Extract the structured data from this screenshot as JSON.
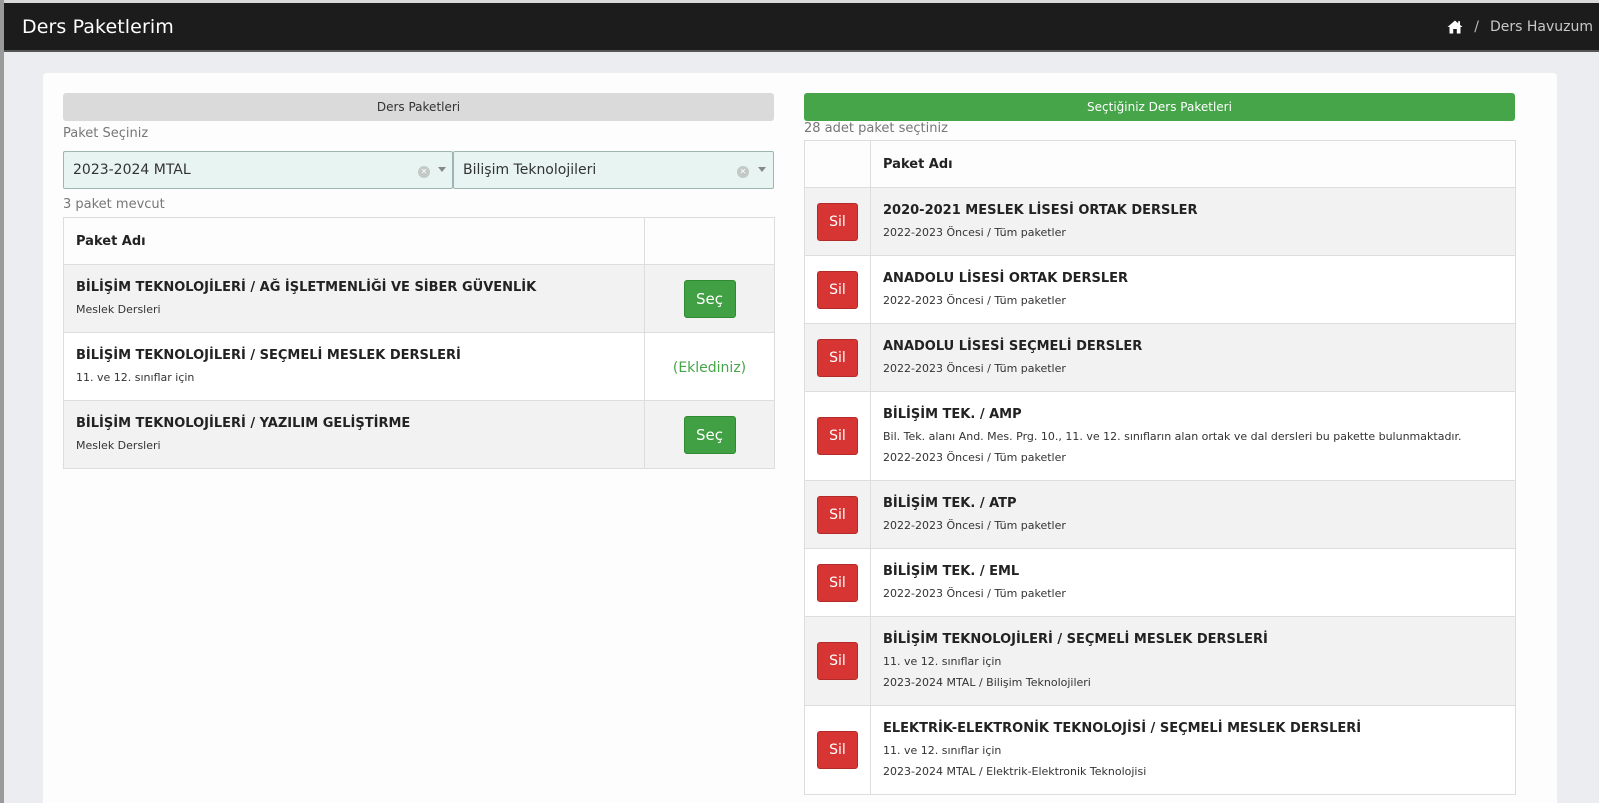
{
  "header": {
    "title": "Ders Paketlerim",
    "home_icon": "home-icon",
    "breadcrumb_sep": "/",
    "breadcrumb_link": "Ders Havuzum"
  },
  "left": {
    "header": "Ders Paketleri",
    "select_label": "Paket Seçiniz",
    "year_select": {
      "value": "2023-2024 MTAL"
    },
    "area_select": {
      "value": "Bilişim Teknolojileri"
    },
    "count_text": "3 paket mevcut",
    "table": {
      "col_name": "Paket Adı",
      "rows": [
        {
          "name": "BİLİŞİM TEKNOLOJİLERİ / AĞ İŞLETMENLİĞİ VE SİBER GÜVENLİK",
          "sub": "Meslek Dersleri",
          "action": "Seç"
        },
        {
          "name": "BİLİŞİM TEKNOLOJİLERİ / SEÇMELİ MESLEK DERSLERİ",
          "sub": "11. ve 12. sınıflar için",
          "action": "(Eklediniz)"
        },
        {
          "name": "BİLİŞİM TEKNOLOJİLERİ / YAZILIM GELİŞTİRME",
          "sub": "Meslek Dersleri",
          "action": "Seç"
        }
      ]
    }
  },
  "right": {
    "header": "Seçtiğiniz Ders Paketleri",
    "count_text": "28 adet paket seçtiniz",
    "table": {
      "col_name": "Paket Adı",
      "action_label": "Sil",
      "rows": [
        {
          "name": "2020-2021 MESLEK LİSESİ ORTAK DERSLER",
          "desc": "",
          "sub": "2022-2023 Öncesi / Tüm paketler"
        },
        {
          "name": "ANADOLU LİSESİ ORTAK DERSLER",
          "desc": "",
          "sub": "2022-2023 Öncesi / Tüm paketler"
        },
        {
          "name": "ANADOLU LİSESİ SEÇMELİ DERSLER",
          "desc": "",
          "sub": "2022-2023 Öncesi / Tüm paketler"
        },
        {
          "name": "BİLİŞİM TEK. / AMP",
          "desc": "Bil. Tek. alanı And. Mes. Prg. 10., 11. ve 12. sınıfların alan ortak ve dal dersleri bu pakette bulunmaktadır.",
          "sub": "2022-2023 Öncesi / Tüm paketler"
        },
        {
          "name": "BİLİŞİM TEK. / ATP",
          "desc": "",
          "sub": "2022-2023 Öncesi / Tüm paketler"
        },
        {
          "name": "BİLİŞİM TEK. / EML",
          "desc": "",
          "sub": "2022-2023 Öncesi / Tüm paketler"
        },
        {
          "name": "BİLİŞİM TEKNOLOJİLERİ / SEÇMELİ MESLEK DERSLERİ",
          "desc": "11. ve 12. sınıflar için",
          "sub": "2023-2024 MTAL / Bilişim Teknolojileri"
        },
        {
          "name": "ELEKTRİK-ELEKTRONİK TEKNOLOJİSİ / SEÇMELİ MESLEK DERSLERİ",
          "desc": "11. ve 12. sınıflar için",
          "sub": "2023-2024 MTAL / Elektrik-Elektronik Teknolojisi"
        }
      ]
    }
  },
  "colors": {
    "topbar": "#1c1c1c",
    "accent_green": "#45a548",
    "danger_red": "#d63534",
    "select_bg": "#e7f4f1"
  }
}
